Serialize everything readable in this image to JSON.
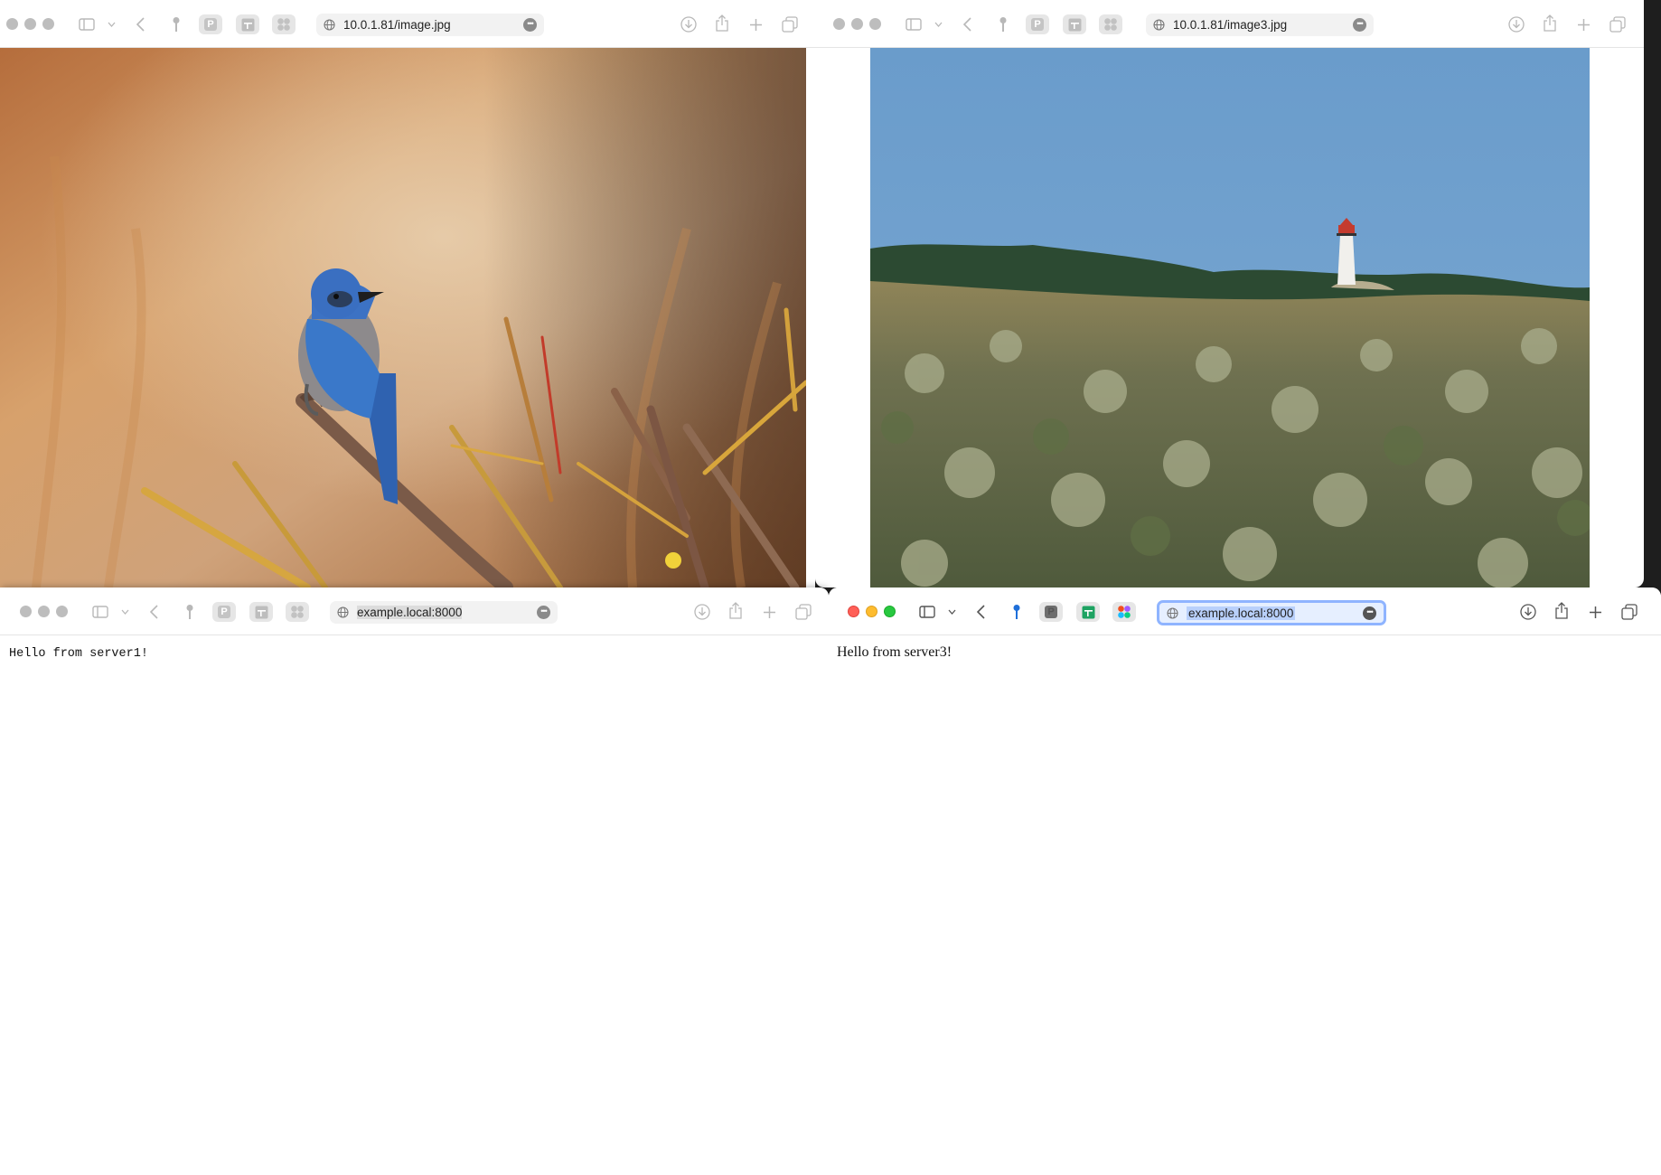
{
  "windows": [
    {
      "id": "w1",
      "url": "10.0.1.81/image.jpg",
      "active": false,
      "content_type": "image",
      "image_subject": "blue jay on branch"
    },
    {
      "id": "w2",
      "url": "10.0.1.81/image3.jpg",
      "active": false,
      "content_type": "image",
      "image_subject": "lighthouse on hill over meadow"
    },
    {
      "id": "w3",
      "url": "example.local:8000",
      "active": false,
      "content_type": "text",
      "text": "Hello from server1!"
    },
    {
      "id": "w4",
      "url": "example.local:8000",
      "active": true,
      "content_type": "text",
      "text": "Hello from server3!"
    }
  ],
  "toolbar_icons": [
    "sidebar-icon",
    "chevron-down-icon",
    "back-icon",
    "key-icon",
    "p-extension-icon",
    "sheets-extension-icon",
    "grid-extension-icon",
    "globe-icon",
    "more-icon",
    "download-icon",
    "share-icon",
    "new-tab-icon",
    "tabs-overview-icon"
  ],
  "colors": {
    "traffic_red": "#ff5f57",
    "traffic_yellow": "#febc2e",
    "traffic_green": "#28c840",
    "focus_ring": "#8fb4ff",
    "sheets_green": "#1ea362",
    "key_blue": "#1e6fd9"
  }
}
